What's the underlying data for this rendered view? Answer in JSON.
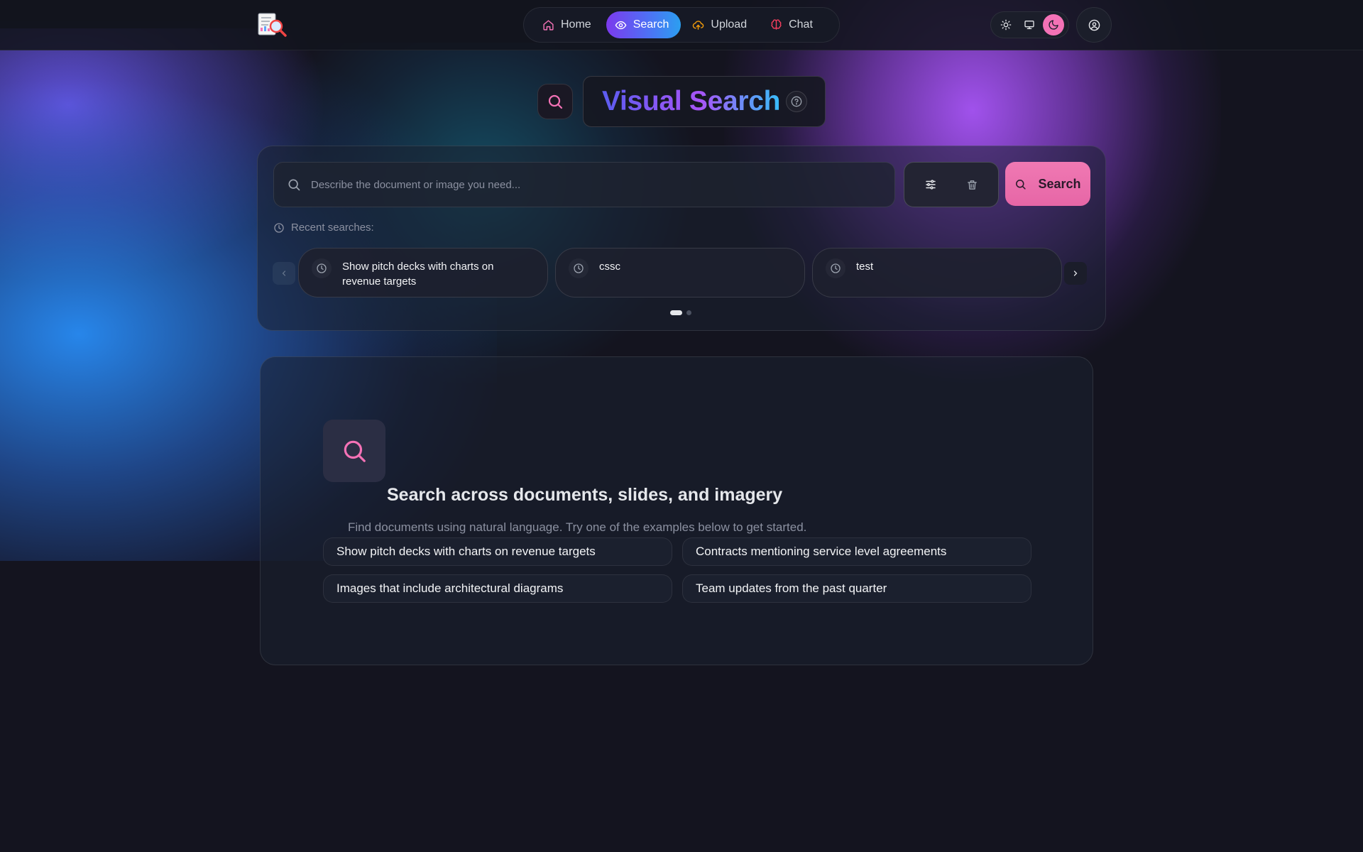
{
  "nav": {
    "items": [
      {
        "label": "Home",
        "icon": "home-icon"
      },
      {
        "label": "Search",
        "icon": "eye-icon",
        "active": true
      },
      {
        "label": "Upload",
        "icon": "cloud-upload-icon"
      },
      {
        "label": "Chat",
        "icon": "brain-icon"
      }
    ],
    "theme_modes": [
      "light",
      "system",
      "dark"
    ],
    "active_theme": "dark"
  },
  "title": {
    "text": "Visual Search"
  },
  "search": {
    "placeholder": "Describe the document or image you need...",
    "value": "",
    "button_label": "Search",
    "recent_label": "Recent searches:",
    "recent": [
      "Show pitch decks with charts on revenue targets",
      "cssc",
      "test"
    ],
    "pages": 2,
    "current_page": 1
  },
  "empty_state": {
    "title": "Search across documents, slides, and imagery",
    "subtitle": "Find documents using natural language. Try one of the examples below to get started.",
    "examples": [
      "Show pitch decks with charts on revenue targets",
      "Contracts mentioning service level agreements",
      "Images that include architectural diagrams",
      "Team updates from the past quarter"
    ]
  },
  "colors": {
    "accent_pink": "#f472b6",
    "background": "#14141f",
    "gradient_start": "#7c3aed",
    "gradient_end": "#2b9ff0"
  }
}
